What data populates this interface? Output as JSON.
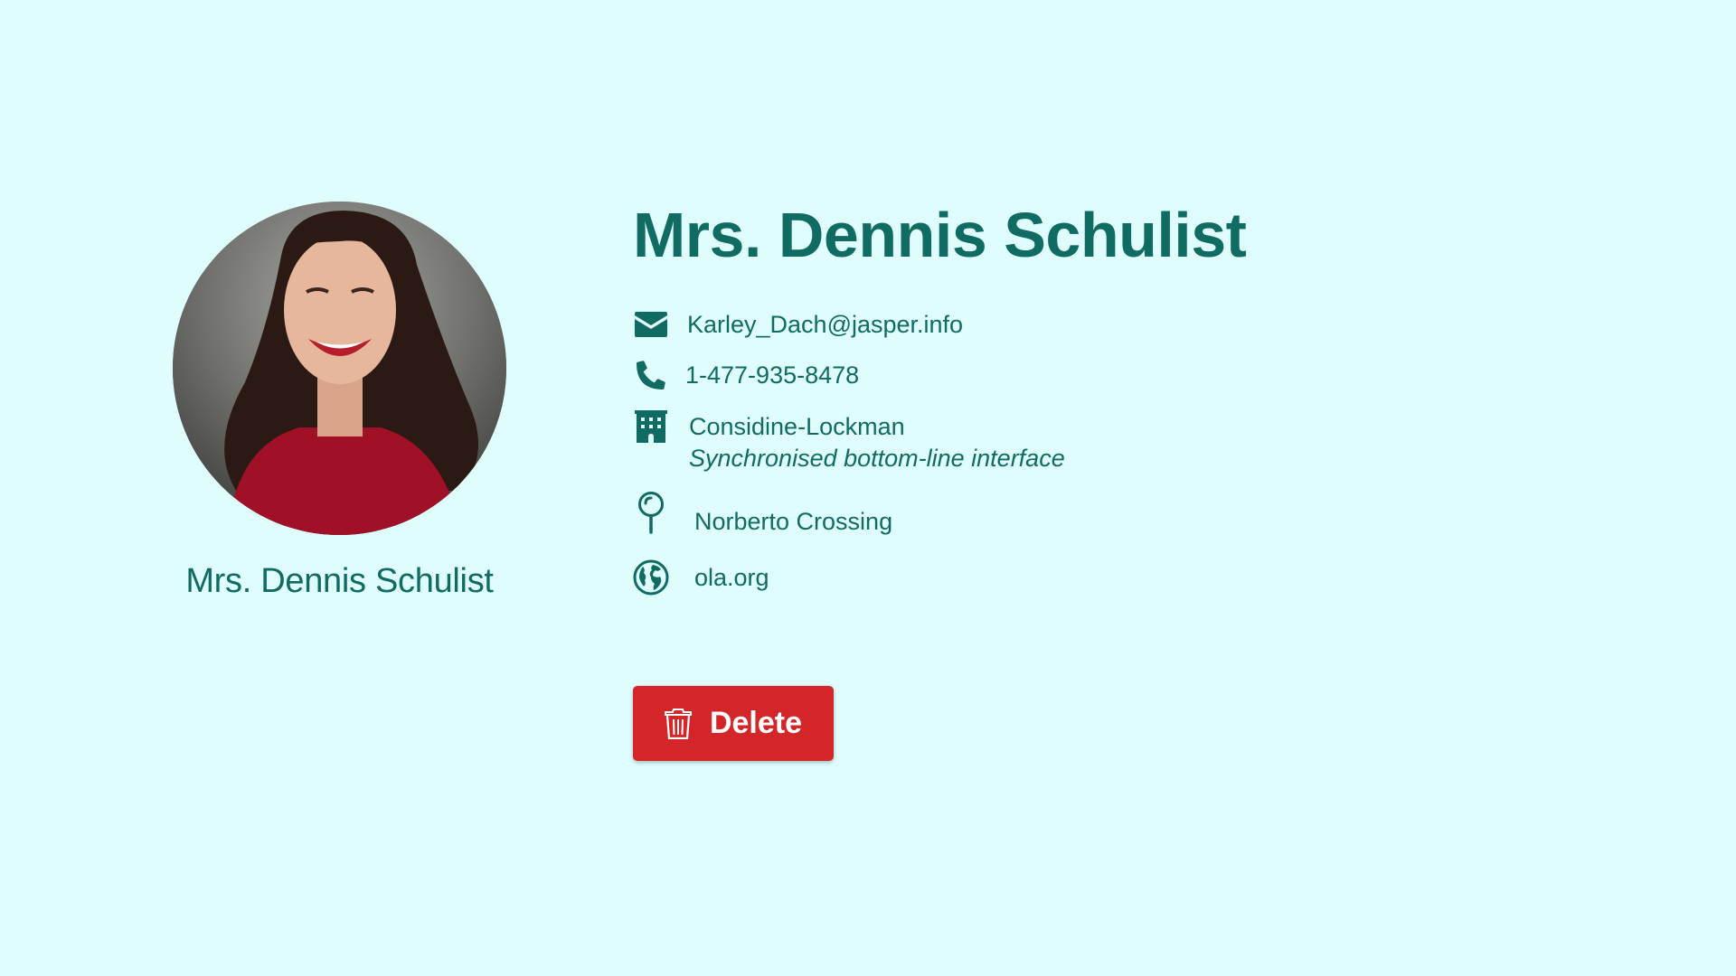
{
  "profile": {
    "name": "Mrs. Dennis Schulist",
    "avatar_caption": "Mrs. Dennis Schulist"
  },
  "contact": {
    "email": "Karley_Dach@jasper.info",
    "phone": "1-477-935-8478",
    "company_name": "Considine-Lockman",
    "company_catchphrase": "Synchronised bottom-line interface",
    "street": "Norberto Crossing",
    "website": "ola.org"
  },
  "icons": {
    "email": "envelope-icon",
    "phone": "phone-icon",
    "company": "building-icon",
    "location": "map-pin-icon",
    "website": "globe-icon",
    "delete": "trash-icon"
  },
  "actions": {
    "delete_label": "Delete"
  },
  "colors": {
    "background": "#dffdfd",
    "text": "#106b63",
    "danger": "#d42629"
  }
}
